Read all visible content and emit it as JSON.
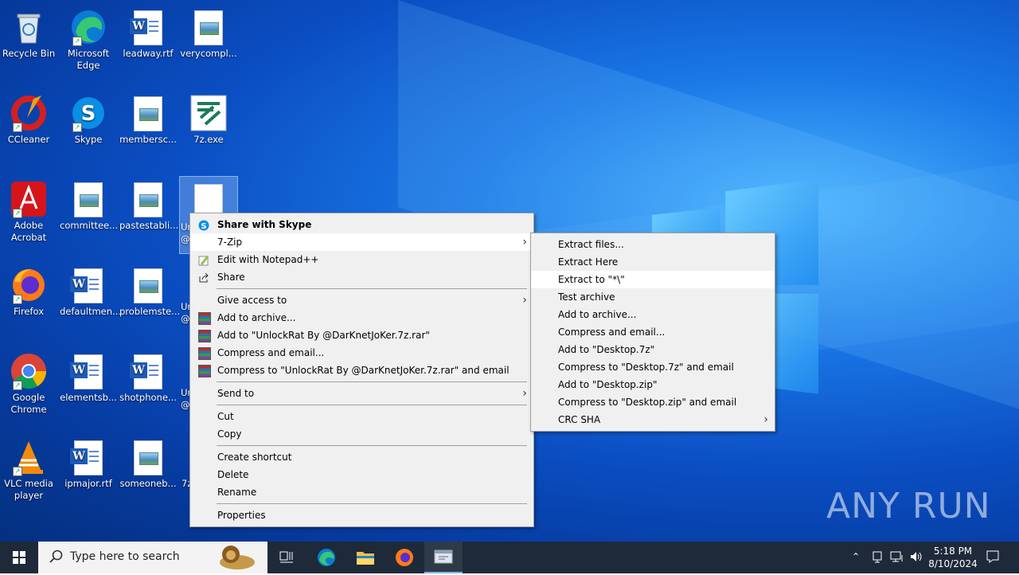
{
  "desktop_icons": [
    {
      "label": "Recycle Bin"
    },
    {
      "label": "Microsoft Edge"
    },
    {
      "label": "leadway.rtf"
    },
    {
      "label": "verycompl..."
    },
    {
      "label": "CCleaner"
    },
    {
      "label": "Skype"
    },
    {
      "label": "membersc..."
    },
    {
      "label": "7z.exe"
    },
    {
      "label": "Adobe Acrobat"
    },
    {
      "label": "committee..."
    },
    {
      "label": "pastestabli..."
    },
    {
      "label": "Firefox"
    },
    {
      "label": "defaultmen..."
    },
    {
      "label": "problemste..."
    },
    {
      "label": "Google Chrome"
    },
    {
      "label": "elementsb..."
    },
    {
      "label": "shotphone..."
    },
    {
      "label": "VLC media player"
    },
    {
      "label": "ipmajor.rtf"
    },
    {
      "label": "someoneb..."
    },
    {
      "label": "7z"
    }
  ],
  "context_menu": {
    "items": [
      {
        "label": "Share with Skype"
      },
      {
        "label": "7-Zip"
      },
      {
        "label": "Edit with Notepad++"
      },
      {
        "label": "Share"
      },
      {
        "label": "Give access to"
      },
      {
        "label": "Add to archive..."
      },
      {
        "label": "Add to \"UnlockRat By @DarKnetJoKer.7z.rar\""
      },
      {
        "label": "Compress and email..."
      },
      {
        "label": "Compress to \"UnlockRat By @DarKnetJoKer.7z.rar\" and email"
      },
      {
        "label": "Send to"
      },
      {
        "label": "Cut"
      },
      {
        "label": "Copy"
      },
      {
        "label": "Create shortcut"
      },
      {
        "label": "Delete"
      },
      {
        "label": "Rename"
      },
      {
        "label": "Properties"
      }
    ]
  },
  "submenu_7zip": {
    "items": [
      {
        "label": "Extract files..."
      },
      {
        "label": "Extract Here"
      },
      {
        "label": "Extract to \"*\\\""
      },
      {
        "label": "Test archive"
      },
      {
        "label": "Add to archive..."
      },
      {
        "label": "Compress and email..."
      },
      {
        "label": "Add to \"Desktop.7z\""
      },
      {
        "label": "Compress to \"Desktop.7z\" and email"
      },
      {
        "label": "Add to \"Desktop.zip\""
      },
      {
        "label": "Compress to \"Desktop.zip\" and email"
      },
      {
        "label": "CRC SHA"
      }
    ]
  },
  "partial_labels": [
    "Ur",
    "@",
    "Ur",
    "@",
    "Ur",
    "@"
  ],
  "taskbar": {
    "search_placeholder": "Type here to search",
    "time": "5:18 PM",
    "date": "8/10/2024"
  },
  "watermark": {
    "text": "ANY RUN"
  }
}
